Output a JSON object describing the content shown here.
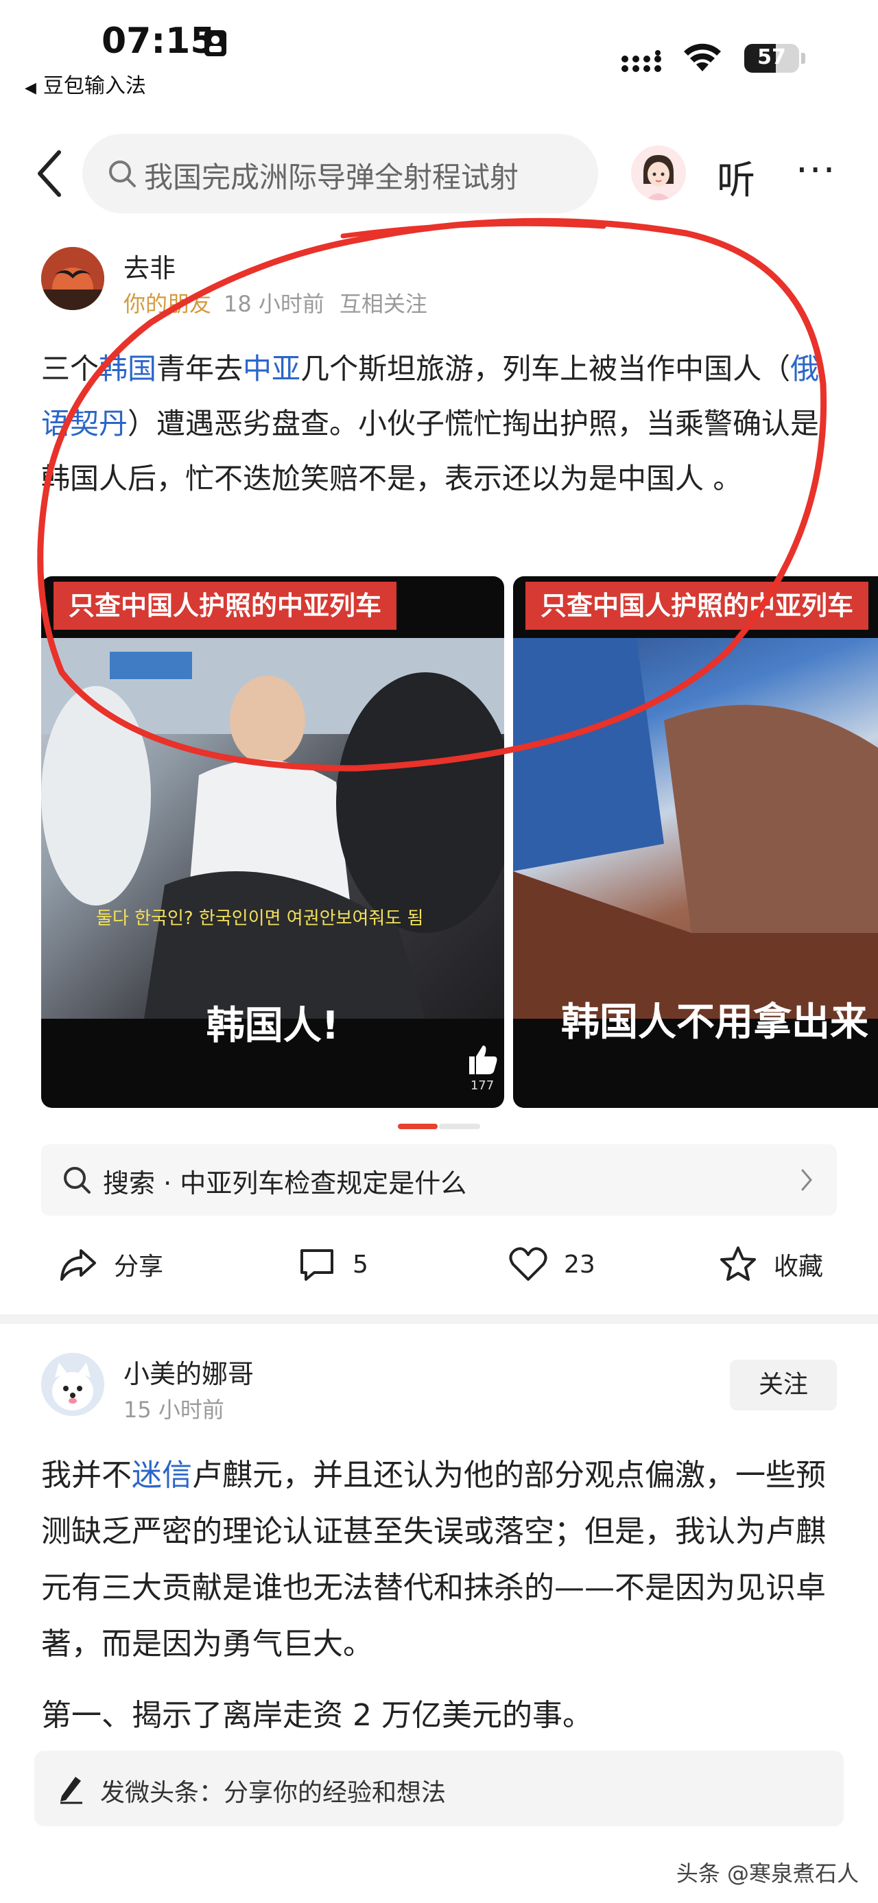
{
  "status_bar": {
    "time": "07:15",
    "back_app": "豆包输入法",
    "battery": "57",
    "battery_level": 0.57
  },
  "nav": {
    "search_text": "我国完成洲际导弹全射程试射",
    "listen_label": "听",
    "more_label": "···"
  },
  "post": {
    "author": "去非",
    "relation": "你的朋友",
    "time": "18 小时前",
    "follow_state": "互相关注",
    "body_parts": [
      {
        "text": "三个",
        "tag": false
      },
      {
        "text": "韩国",
        "tag": true
      },
      {
        "text": "青年去",
        "tag": false
      },
      {
        "text": "中亚",
        "tag": true
      },
      {
        "text": "几个斯坦旅游，列车上被当作中国人（",
        "tag": false
      },
      {
        "text": "俄语契丹",
        "tag": true
      },
      {
        "text": "）遭遇恶劣盘查。小伙子慌忙掏出护照，当乘警确认是韩国人后，忙不迭尬笑赔不是，表示还以为是中国人 。",
        "tag": false
      }
    ]
  },
  "videos": [
    {
      "banner": "只查中国人护照的中亚列车",
      "korean_subtitle": "둘다 한국인? 한국인이면 여권안보여줘도 됨",
      "caption": "韩国人!",
      "like_count": "177"
    },
    {
      "banner": "只查中国人护照的中亚列车",
      "caption": "韩国人不用拿出来"
    }
  ],
  "suggest": {
    "text": "搜索 · 中亚列车检查规定是什么"
  },
  "actions": {
    "share": "分享",
    "comments": "5",
    "likes": "23",
    "favorite": "收藏"
  },
  "comment": {
    "author": "小美的娜哥",
    "time": "15 小时前",
    "follow": "关注",
    "body_parts": [
      {
        "text": "我并不",
        "tag": false
      },
      {
        "text": "迷信",
        "tag": true
      },
      {
        "text": "卢麒元，并且还认为他的部分观点偏激，一些预测缺乏严密的理论认证甚至失误或落空；但是，我认为卢麒元有三大贡献是谁也无法替代和抹杀的——不是因为见识卓著，而是因为勇气巨大。",
        "tag": false
      }
    ],
    "body2": "第一、揭示了离岸走资 2 万亿美元的事。"
  },
  "compose": {
    "placeholder": "发微头条：分享你的经验和想法"
  },
  "watermark": "头条 @寒泉煮石人",
  "colors": {
    "accent_red": "#e8412f",
    "link_blue": "#2b66c8",
    "friend_gold": "#d49a3e"
  }
}
